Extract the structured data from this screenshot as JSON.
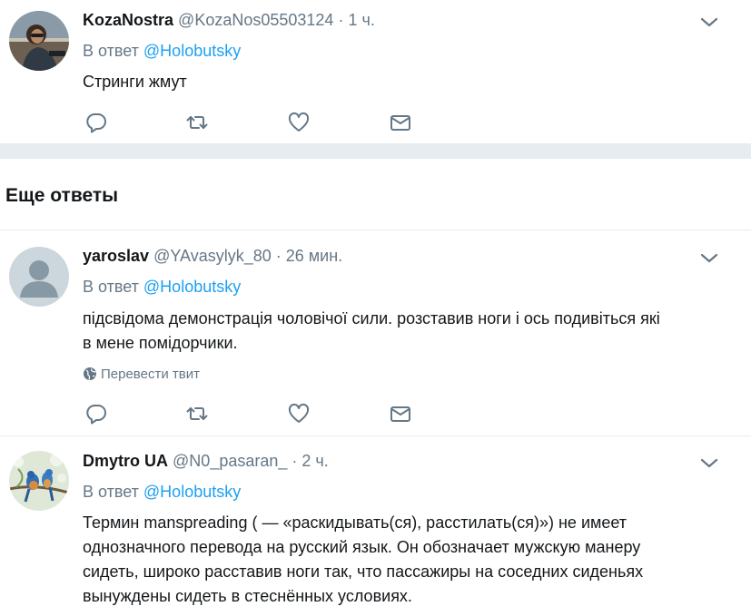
{
  "tweets": [
    {
      "name": "KozaNostra",
      "handle": "@KozaNos05503124",
      "sep": "·",
      "time": "1 ч.",
      "reply_prefix": "В ответ",
      "reply_mention": "@Holobutsky",
      "text": "Стринги жмут",
      "avatar_icon": "user-photo-avatar"
    },
    {
      "name": "yaroslav",
      "handle": "@YAvasylyk_80",
      "sep": "·",
      "time": "26 мин.",
      "reply_prefix": "В ответ",
      "reply_mention": "@Holobutsky",
      "text_lines": [
        "підсвідома демонстрація чоловічої сили. розставив ноги і ось подивіться які",
        "в мене помідорчики."
      ],
      "translate_label": "Перевести твит",
      "avatar_icon": "default-user-avatar"
    },
    {
      "name": "Dmytro UA",
      "handle": "@N0_pasaran_",
      "sep": "·",
      "time": "2 ч.",
      "reply_prefix": "В ответ",
      "reply_mention": "@Holobutsky",
      "text_lines": [
        "Термин manspreading ( — «раскидывать(ся), расстилать(ся)») не имеет",
        "однозначного перевода на русский язык. Он обозначает мужскую манеру",
        "сидеть, широко расставив ноги так, что пассажиры на соседних сиденьях",
        "вынуждены сидеть в стеснённых условиях."
      ],
      "avatar_icon": "birds-photo-avatar"
    }
  ],
  "section": {
    "title": "Еще ответы"
  },
  "icons": [
    "reply-icon",
    "retweet-icon",
    "like-icon",
    "direct-message-icon",
    "chevron-down-icon",
    "globe-icon"
  ],
  "colors": {
    "link": "#1da1f2",
    "muted": "#657786",
    "separator": "#e6ecf0",
    "text": "#14171a"
  }
}
